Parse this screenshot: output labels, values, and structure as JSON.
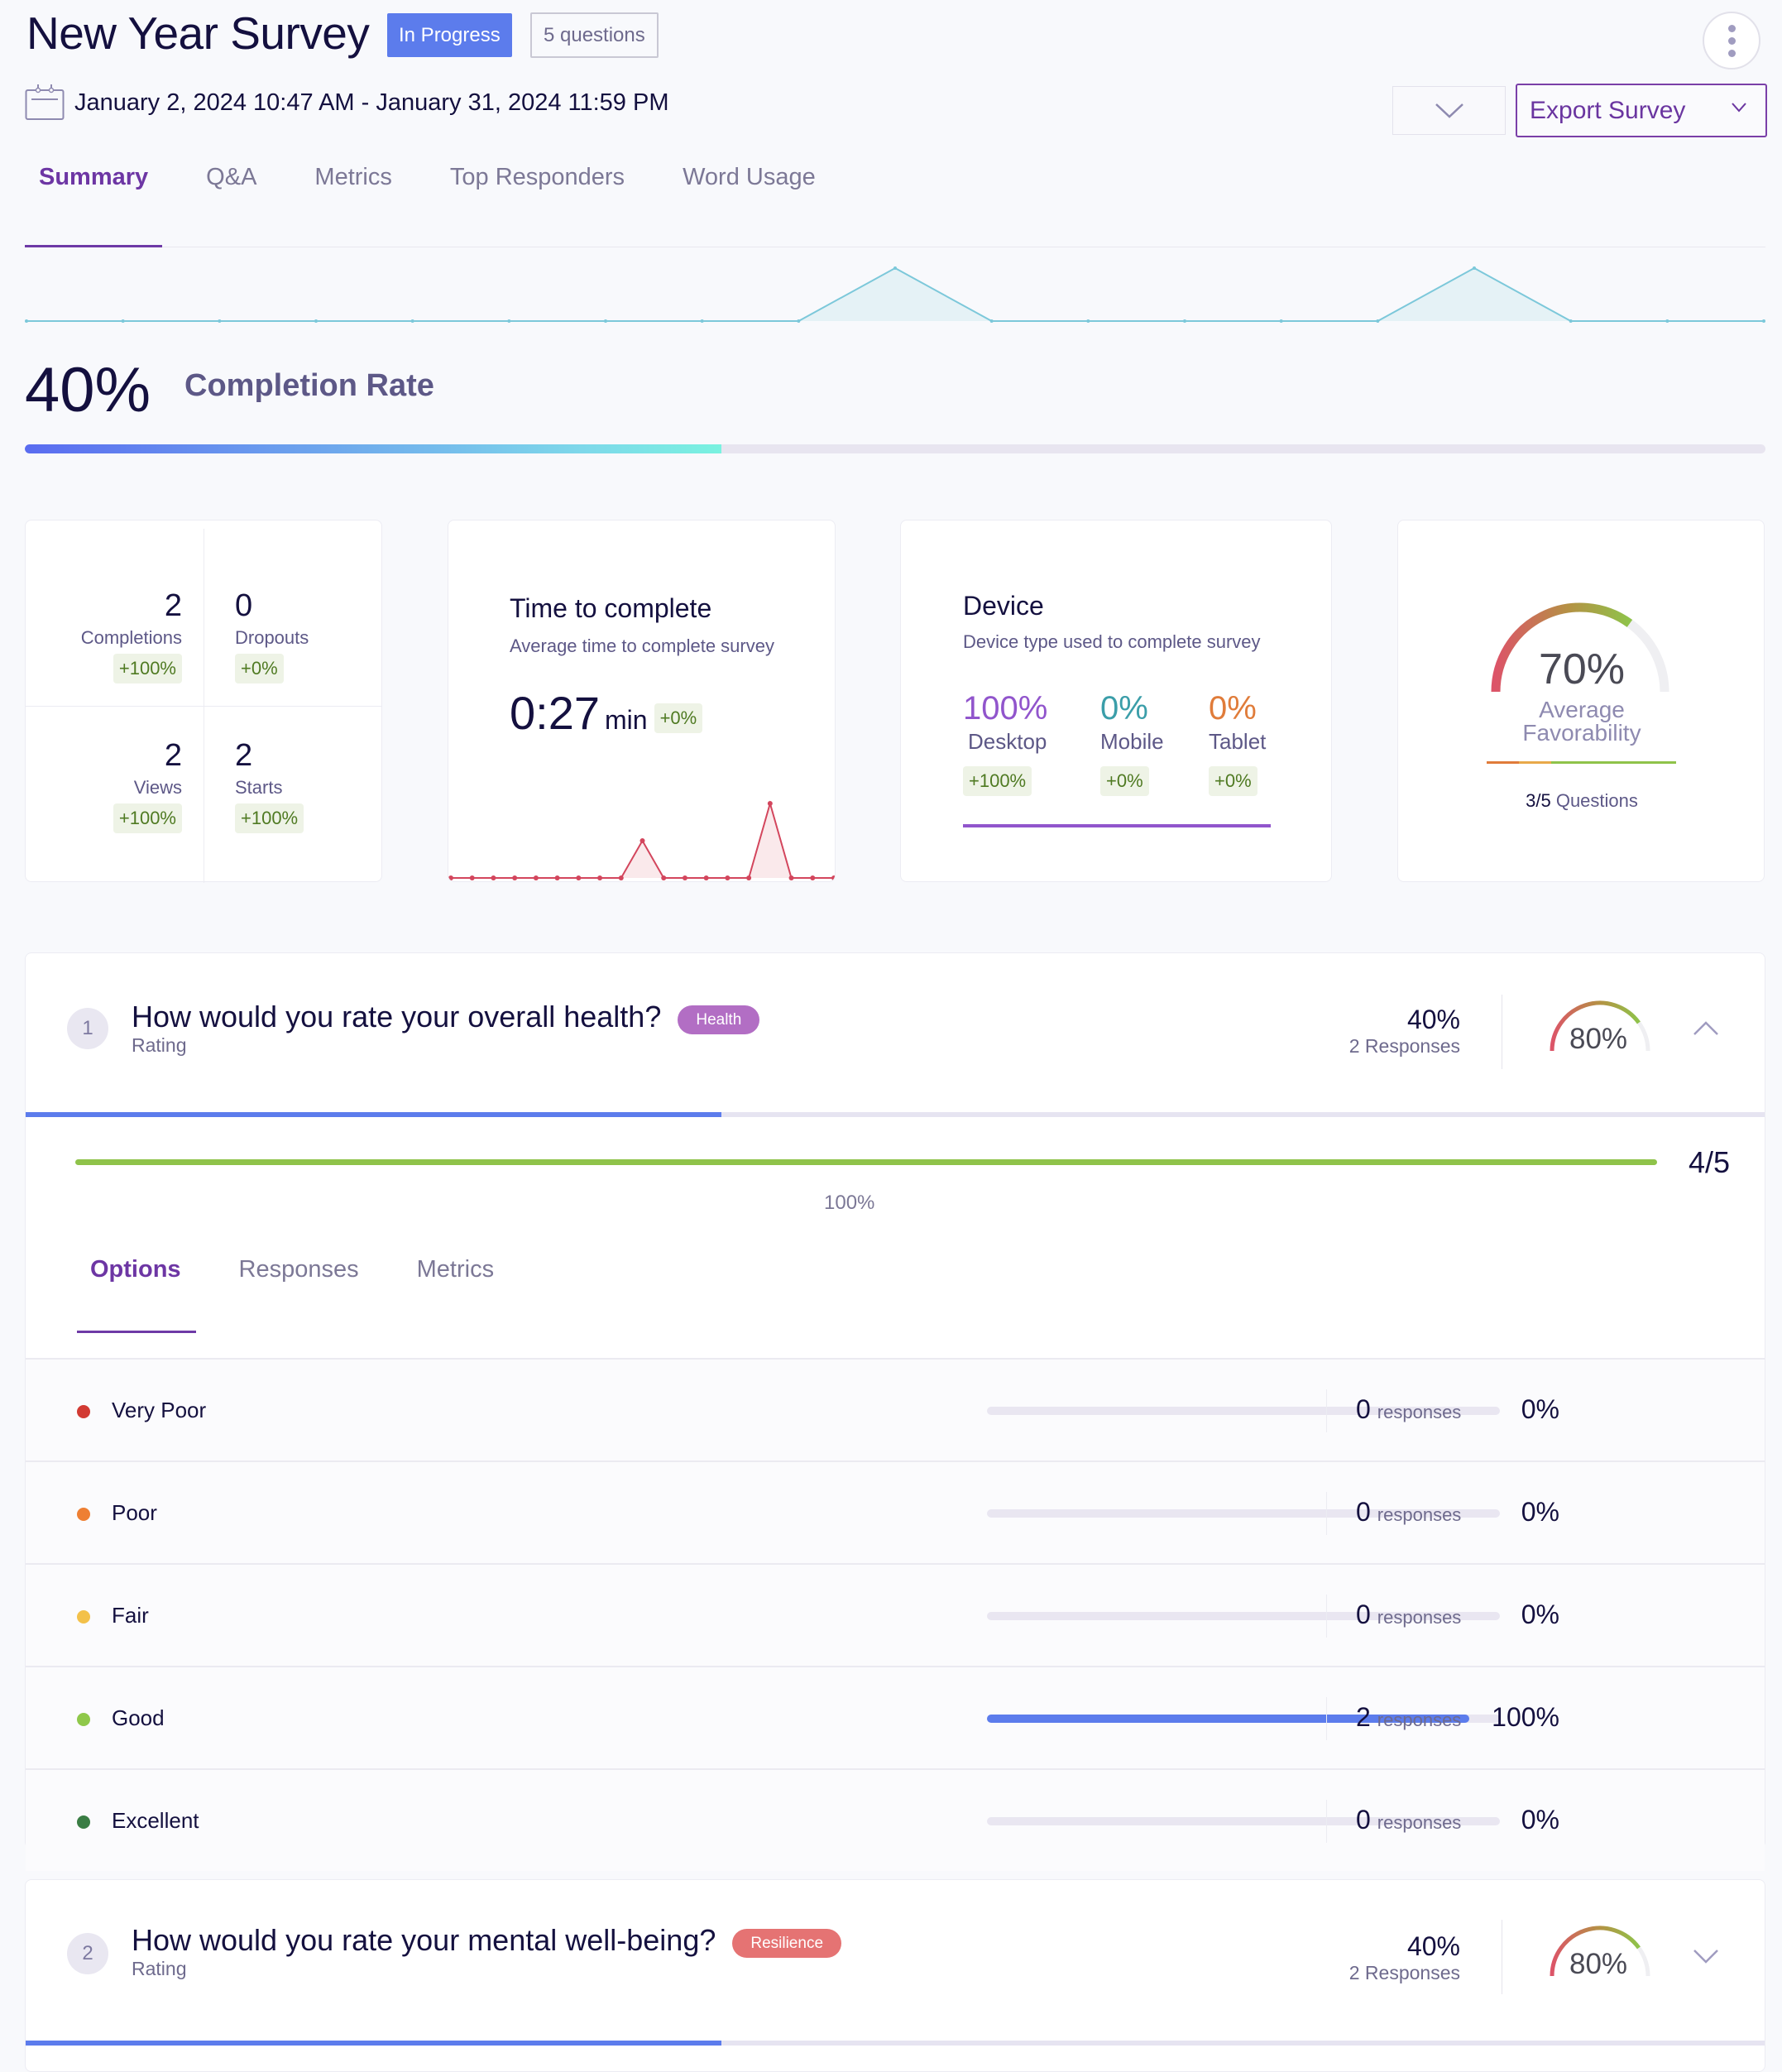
{
  "header": {
    "title": "New Year Survey",
    "status_badge": "In Progress",
    "question_count_badge": "5 questions",
    "date_range": "January 2, 2024 10:47 AM - January 31, 2024 11:59 PM",
    "export_label": "Export Survey",
    "icons": {
      "calendar": "calendar-icon",
      "more": "kebab-menu-icon",
      "dropdown": "chevron-down-icon"
    }
  },
  "tabs": [
    {
      "label": "Summary",
      "active": true
    },
    {
      "label": "Q&A",
      "active": false
    },
    {
      "label": "Metrics",
      "active": false
    },
    {
      "label": "Top Responders",
      "active": false
    },
    {
      "label": "Word Usage",
      "active": false
    }
  ],
  "activity_sparkline": {
    "values": [
      0,
      0,
      0,
      0,
      0,
      0,
      0,
      0,
      0,
      1,
      0,
      0,
      0,
      0,
      0,
      1,
      0,
      0,
      0
    ],
    "color": "#7cc8da"
  },
  "completion": {
    "percent_label": "40%",
    "value": 40,
    "label": "Completion Rate"
  },
  "stats": [
    {
      "value": "2",
      "label": "Completions",
      "delta": "+100%"
    },
    {
      "value": "0",
      "label": "Dropouts",
      "delta": "+0%"
    },
    {
      "value": "2",
      "label": "Views",
      "delta": "+100%"
    },
    {
      "value": "2",
      "label": "Starts",
      "delta": "+100%"
    }
  ],
  "time_to_complete": {
    "title": "Time to complete",
    "subtitle": "Average time to complete survey",
    "value": "0:27",
    "unit": "min",
    "delta": "+0%",
    "sparkline": [
      0,
      0,
      0,
      0,
      0,
      0,
      0,
      0,
      0,
      1,
      0,
      0,
      0,
      0,
      0,
      2,
      0,
      0,
      0
    ],
    "color": "#d3465d"
  },
  "device": {
    "title": "Device",
    "subtitle": "Device type used to complete survey",
    "items": [
      {
        "pct": "100%",
        "label": "Desktop",
        "delta": "+100%",
        "color": "#9155cc"
      },
      {
        "pct": "0%",
        "label": "Mobile",
        "delta": "+0%",
        "color": "#3b9ea9"
      },
      {
        "pct": "0%",
        "label": "Tablet",
        "delta": "+0%",
        "color": "#e07c3a"
      }
    ]
  },
  "favorability": {
    "value": 70,
    "pct_label": "70%",
    "label_line1": "Average",
    "label_line2": "Favorability",
    "questions_fraction": "3/5",
    "questions_word": "Questions"
  },
  "questions": [
    {
      "number": "1",
      "title": "How would you rate your overall health?",
      "type": "Rating",
      "tag": "Health",
      "tag_color": "#b26ec4",
      "response_pct": "40%",
      "response_progress": 40,
      "responses_label": "2 Responses",
      "gauge_value": 80,
      "gauge_label": "80%",
      "expanded": true,
      "distribution_score": "4/5",
      "distribution_pct": "100%",
      "subtabs": [
        {
          "label": "Options",
          "active": true
        },
        {
          "label": "Responses",
          "active": false
        },
        {
          "label": "Metrics",
          "active": false
        }
      ],
      "options": [
        {
          "label": "Very Poor",
          "color": "#d23a33",
          "pct": "0%",
          "value": 0,
          "count": "0",
          "count_label": "responses"
        },
        {
          "label": "Poor",
          "color": "#ee7f33",
          "pct": "0%",
          "value": 0,
          "count": "0",
          "count_label": "responses"
        },
        {
          "label": "Fair",
          "color": "#f3c14a",
          "pct": "0%",
          "value": 0,
          "count": "0",
          "count_label": "responses"
        },
        {
          "label": "Good",
          "color": "#8fc84a",
          "pct": "100%",
          "value": 100,
          "count": "2",
          "count_label": "responses"
        },
        {
          "label": "Excellent",
          "color": "#3a7d44",
          "pct": "0%",
          "value": 0,
          "count": "0",
          "count_label": "responses"
        }
      ]
    },
    {
      "number": "2",
      "title": "How would you rate your mental well-being?",
      "type": "Rating",
      "tag": "Resilience",
      "tag_color": "#e57373",
      "response_pct": "40%",
      "response_progress": 40,
      "responses_label": "2 Responses",
      "gauge_value": 80,
      "gauge_label": "80%",
      "expanded": false
    }
  ]
}
